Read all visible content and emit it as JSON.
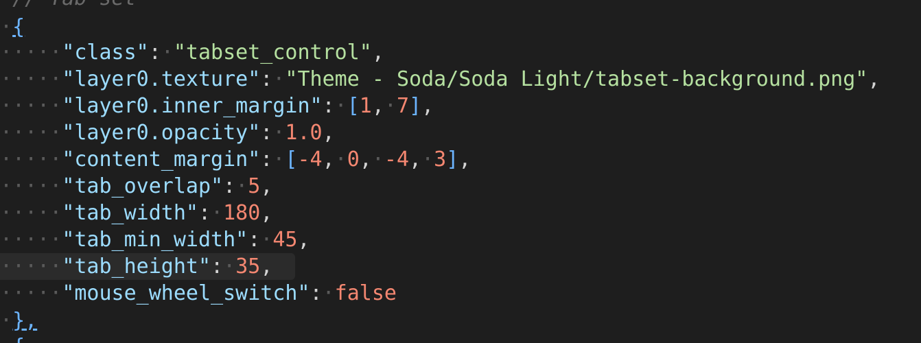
{
  "lines": {
    "comment": "// Tab set",
    "open_brace": "{",
    "class_key": "\"class\"",
    "class_val": "\"tabset_control\"",
    "texture_key": "\"layer0.texture\"",
    "texture_val": "\"Theme - Soda/Soda Light/tabset-background.png\"",
    "inner_margin_key": "\"layer0.inner_margin\"",
    "inner_margin_1": "1",
    "inner_margin_2": "7",
    "opacity_key": "\"layer0.opacity\"",
    "opacity_val": "1.0",
    "content_margin_key": "\"content_margin\"",
    "content_margin_1": "-4",
    "content_margin_2": "0",
    "content_margin_3": "-4",
    "content_margin_4": "3",
    "tab_overlap_key": "\"tab_overlap\"",
    "tab_overlap_val": "5",
    "tab_width_key": "\"tab_width\"",
    "tab_width_val": "180",
    "tab_min_width_key": "\"tab_min_width\"",
    "tab_min_width_val": "45",
    "tab_height_key": "\"tab_height\"",
    "tab_height_val": "35",
    "mouse_wheel_key": "\"mouse_wheel_switch\"",
    "mouse_wheel_val": "false",
    "close_brace": "},",
    "next_brace": "{"
  },
  "colors": {
    "background": "#1e1e1e",
    "key": "#9cdcfe",
    "string": "#b5e0a0",
    "number": "#f48771",
    "bracket": "#6cb4ff",
    "whitespace_dot": "#5a5a5a",
    "current_line": "#2b2b2b"
  }
}
